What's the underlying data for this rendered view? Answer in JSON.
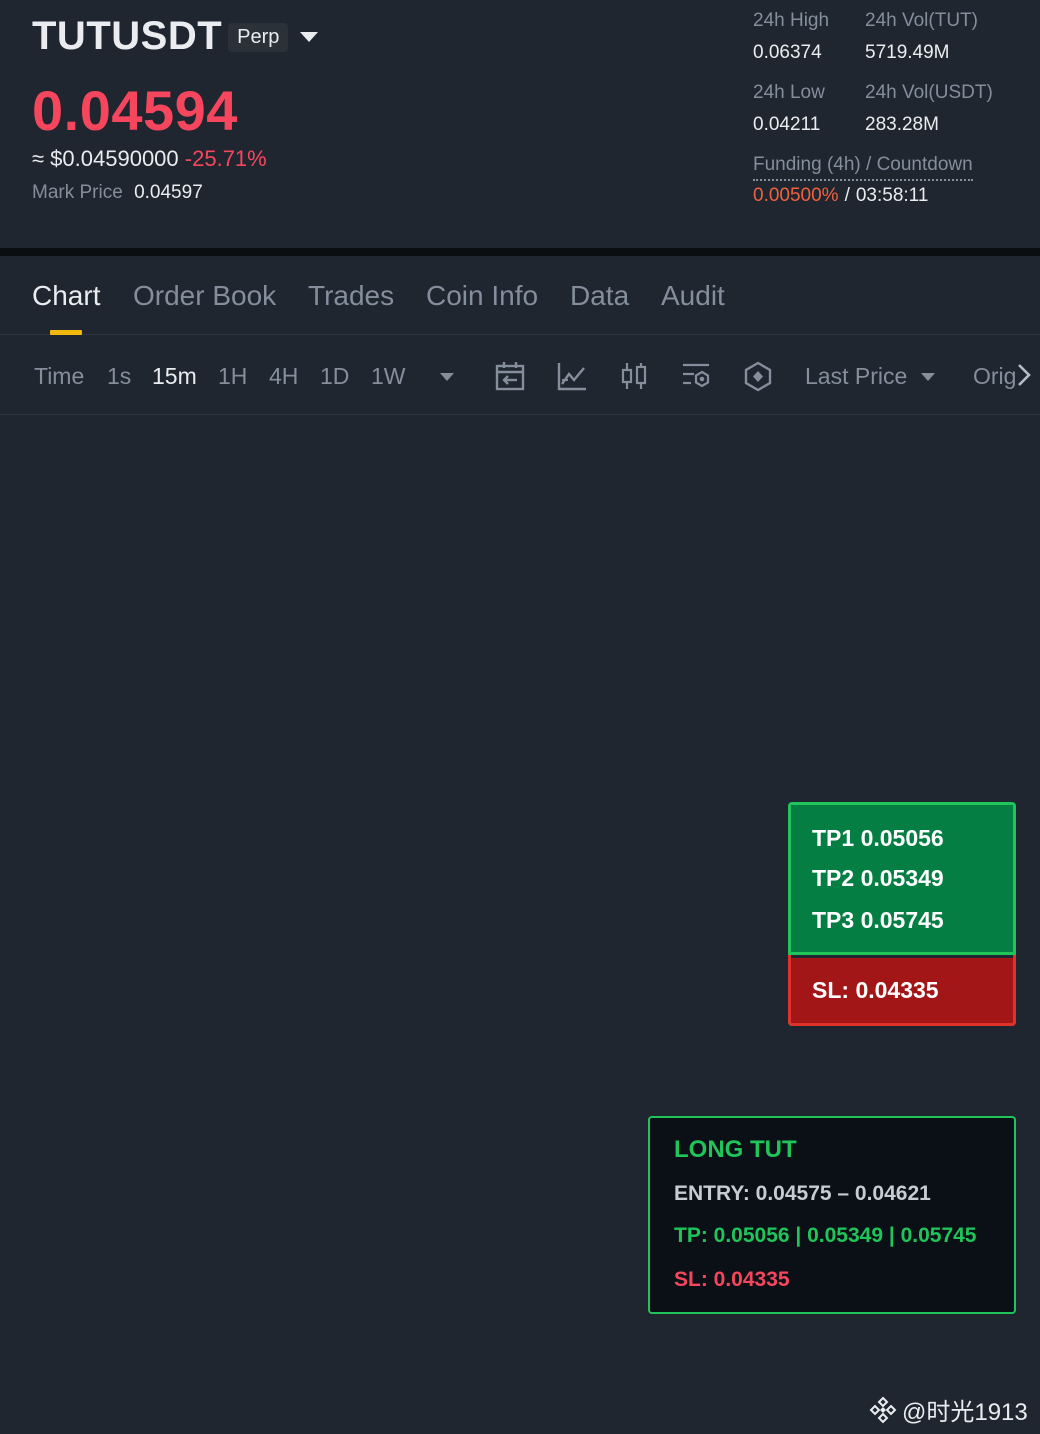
{
  "header": {
    "symbol": "TUTUSDT",
    "contract_type": "Perp",
    "last_price": "0.04594",
    "usd_approx": "≈ $0.04590000",
    "change_pct": "-25.71%",
    "mark_price_label": "Mark Price",
    "mark_price": "0.04597",
    "stats": {
      "high_label": "24h High",
      "high": "0.06374",
      "vol_base_label": "24h Vol(TUT)",
      "vol_base": "5719.49M",
      "low_label": "24h Low",
      "low": "0.04211",
      "vol_quote_label": "24h Vol(USDT)",
      "vol_quote": "283.28M",
      "funding_label": "Funding (4h) / Countdown",
      "funding_rate": "0.00500%",
      "funding_sep": "/",
      "countdown": "03:58:11"
    }
  },
  "tabs": [
    {
      "label": "Chart",
      "active": true
    },
    {
      "label": "Order Book"
    },
    {
      "label": "Trades"
    },
    {
      "label": "Coin Info"
    },
    {
      "label": "Data"
    },
    {
      "label": "Audit"
    }
  ],
  "toolbar": {
    "timeframes": [
      {
        "label": "Time"
      },
      {
        "label": "1s"
      },
      {
        "label": "15m",
        "active": true
      },
      {
        "label": "1H"
      },
      {
        "label": "4H"
      },
      {
        "label": "1D"
      },
      {
        "label": "1W"
      }
    ],
    "icons": [
      "calendar-range-icon",
      "indicator-chart-icon",
      "candlestick-icon",
      "chart-settings-icon",
      "hexagon-tools-icon"
    ],
    "price_source": "Last Price",
    "view_mode_partial": "Orig"
  },
  "targets_box": {
    "tp1": "TP1 0.05056",
    "tp2": "TP2 0.05349",
    "tp3": "TP3 0.05745",
    "sl": "SL: 0.04335"
  },
  "signal_box": {
    "title": "LONG TUT",
    "entry": "ENTRY: 0.04575 – 0.04621",
    "tp": "TP: 0.05056 | 0.05349 | 0.05745",
    "sl": "SL: 0.04335"
  },
  "watermark": {
    "text": "@时光1913"
  },
  "colors": {
    "background": "#1f2630",
    "price_down": "#f6465d",
    "funding": "#f0613f",
    "accent": "#f0b90b",
    "green": "#1fc45a",
    "tp_fill": "#057e43",
    "sl_fill": "#a21618"
  }
}
